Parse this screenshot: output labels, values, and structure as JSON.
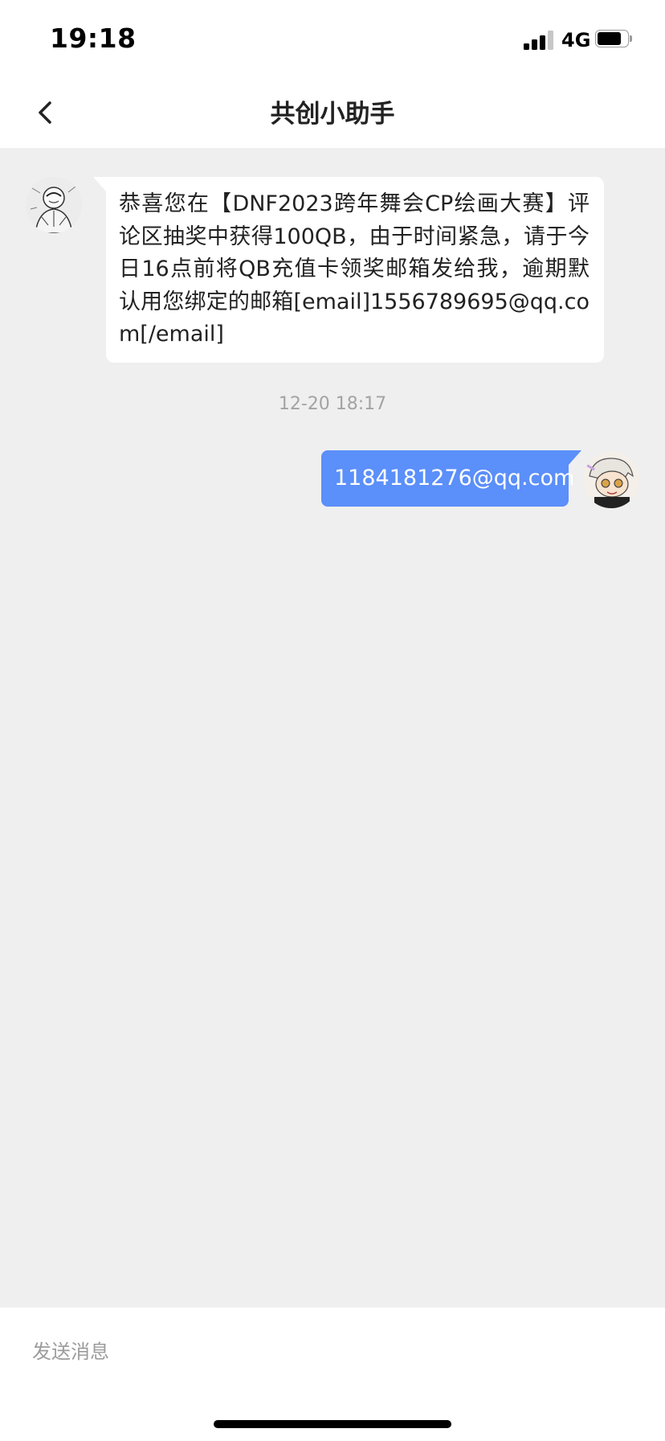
{
  "status_bar": {
    "time": "19:18",
    "network": "4G",
    "signal_bars_total": 4,
    "signal_bars_active": 3,
    "battery_level": 0.8
  },
  "nav": {
    "title": "共创小助手",
    "back_icon": "chevron-left-icon"
  },
  "messages": [
    {
      "sender": "other",
      "avatar_icon": "sketch-figure-avatar",
      "text": "恭喜您在【DNF2023跨年舞会CP绘画大赛】评论区抽奖中获得100QB，由于时间紧急，请于今日16点前将QB充值卡领奖邮箱发给我，逾期默认用您绑定的邮箱[email]1556789695@qq.com[/email]"
    },
    {
      "sender": "timestamp",
      "text": "12-20 18:17"
    },
    {
      "sender": "me",
      "avatar_icon": "cartoon-character-avatar",
      "text": "1184181276@qq.com"
    }
  ],
  "input": {
    "placeholder": "发送消息",
    "value": ""
  },
  "colors": {
    "accent": "#5b8ff9",
    "chat_background": "#efefef",
    "bar_background": "#ffffff"
  }
}
